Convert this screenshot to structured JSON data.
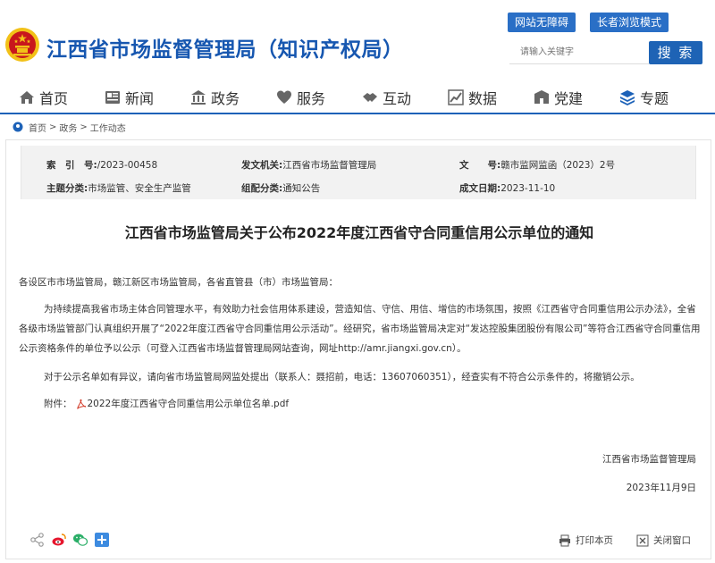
{
  "header": {
    "site_title": "江西省市场监督管理局（知识产权局）",
    "accessibility_label": "网站无障碍",
    "elder_mode_label": "长者浏览模式",
    "search_placeholder": "请输入关键字",
    "search_button": "搜 索",
    "colors": {
      "primary": "#1d62b8",
      "emblem_red": "#c8161d",
      "emblem_gold": "#f2c118"
    }
  },
  "nav": {
    "items": [
      {
        "label": "首页",
        "icon": "home-icon"
      },
      {
        "label": "新闻",
        "icon": "news-icon"
      },
      {
        "label": "政务",
        "icon": "government-icon"
      },
      {
        "label": "服务",
        "icon": "service-icon"
      },
      {
        "label": "互动",
        "icon": "interaction-icon"
      },
      {
        "label": "数据",
        "icon": "data-icon"
      },
      {
        "label": "党建",
        "icon": "party-icon"
      },
      {
        "label": "专题",
        "icon": "topic-icon"
      }
    ]
  },
  "breadcrumb": {
    "items": [
      "首页",
      "政务",
      "工作动态"
    ],
    "separator": ">"
  },
  "meta": {
    "index_label": "索　引　号:",
    "index_value": "/2023-00458",
    "issuer_label": "发文机关:",
    "issuer_value": "江西省市场监督管理局",
    "docno_label": "文　　号:",
    "docno_value": "赣市监网监函（2023）2号",
    "topic_label": "主题分类:",
    "topic_value": "市场监管、安全生产监管",
    "org_label": "组配分类:",
    "org_value": "通知公告",
    "date_label": "成文日期:",
    "date_value": "2023-11-10"
  },
  "article": {
    "title": "江西省市场监管局关于公布2022年度江西省守合同重信用公示单位的通知",
    "salutation": "各设区市市场监管局，赣江新区市场监管局，各省直管县（市）市场监管局：",
    "paragraph1": "为持续提高我省市场主体合同管理水平，有效助力社会信用体系建设，营造知信、守信、用信、增信的市场氛围，按照《江西省守合同重信用公示办法》，全省各级市场监管部门认真组织开展了“2022年度江西省守合同重信用公示活动”。经研究，省市场监管局决定对“发达控股集团股份有限公司”等符合江西省守合同重信用公示资格条件的单位予以公示（可登入江西省市场监督管理局网站查询，网址http://amr.jiangxi.gov.cn）。",
    "paragraph2": "对于公示名单如有异议，请向省市场监管局网监处提出（联系人：聂招前，电话：13607060351），经查实有不符合公示条件的，将撤销公示。",
    "attachment_label": "附件：",
    "attachment_name": "2022年度江西省守合同重信用公示单位名单.pdf",
    "signature_org": "江西省市场监督管理局",
    "signature_date": "2023年11月9日"
  },
  "footer": {
    "print_label": "打印本页",
    "close_label": "关闭窗口"
  }
}
